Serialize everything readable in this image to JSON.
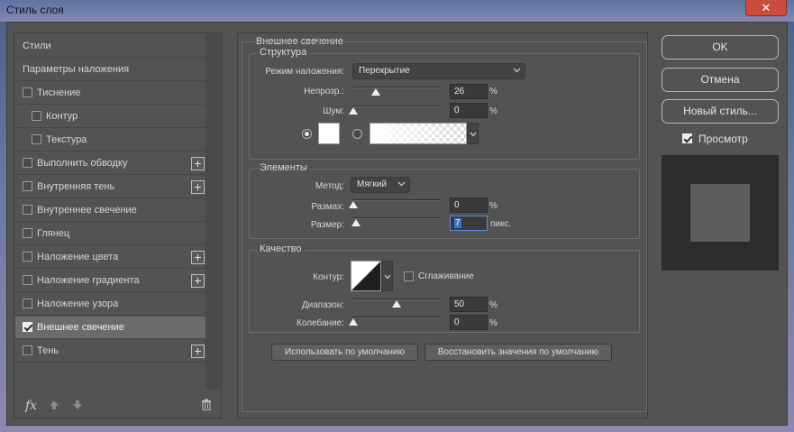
{
  "window": {
    "title": "Стиль слоя",
    "close_glyph": "✕"
  },
  "styles_list": {
    "items": [
      {
        "label": "Стили",
        "has_checkbox": false,
        "checked": false,
        "has_add": false,
        "indent": false,
        "selected": false
      },
      {
        "label": "Параметры наложения",
        "has_checkbox": false,
        "checked": false,
        "has_add": false,
        "indent": false,
        "selected": false
      },
      {
        "label": "Тиснение",
        "has_checkbox": true,
        "checked": false,
        "has_add": false,
        "indent": false,
        "selected": false
      },
      {
        "label": "Контур",
        "has_checkbox": true,
        "checked": false,
        "has_add": false,
        "indent": true,
        "selected": false
      },
      {
        "label": "Текстура",
        "has_checkbox": true,
        "checked": false,
        "has_add": false,
        "indent": true,
        "selected": false
      },
      {
        "label": "Выполнить обводку",
        "has_checkbox": true,
        "checked": false,
        "has_add": true,
        "indent": false,
        "selected": false
      },
      {
        "label": "Внутренняя тень",
        "has_checkbox": true,
        "checked": false,
        "has_add": true,
        "indent": false,
        "selected": false
      },
      {
        "label": "Внутреннее свечение",
        "has_checkbox": true,
        "checked": false,
        "has_add": false,
        "indent": false,
        "selected": false
      },
      {
        "label": "Глянец",
        "has_checkbox": true,
        "checked": false,
        "has_add": false,
        "indent": false,
        "selected": false
      },
      {
        "label": "Наложение цвета",
        "has_checkbox": true,
        "checked": false,
        "has_add": true,
        "indent": false,
        "selected": false
      },
      {
        "label": "Наложение градиента",
        "has_checkbox": true,
        "checked": false,
        "has_add": true,
        "indent": false,
        "selected": false
      },
      {
        "label": "Наложение узора",
        "has_checkbox": true,
        "checked": false,
        "has_add": false,
        "indent": false,
        "selected": false
      },
      {
        "label": "Внешнее свечение",
        "has_checkbox": true,
        "checked": true,
        "has_add": false,
        "indent": false,
        "selected": true
      },
      {
        "label": "Тень",
        "has_checkbox": true,
        "checked": false,
        "has_add": true,
        "indent": false,
        "selected": false
      }
    ],
    "footer": {
      "fx_label": "fx"
    }
  },
  "outer_glow": {
    "section_title": "Внешнее свечение",
    "structure": {
      "title": "Структура",
      "blend_mode_label": "Режим наложения:",
      "blend_mode_value": "Перекрытие",
      "opacity_label": "Непрозр.:",
      "opacity_value": "26",
      "opacity_unit": "%",
      "opacity_fraction": 0.26,
      "noise_label": "Шум:",
      "noise_value": "0",
      "noise_unit": "%",
      "noise_fraction": 0.0,
      "color_mode": "solid",
      "glow_color": "#ffffff"
    },
    "elements": {
      "title": "Элементы",
      "technique_label": "Метод:",
      "technique_value": "Мягкий",
      "spread_label": "Размах:",
      "spread_value": "0",
      "spread_unit": "%",
      "spread_fraction": 0.0,
      "size_label": "Размер:",
      "size_value": "7",
      "size_unit": "пикс.",
      "size_fraction": 0.03
    },
    "quality": {
      "title": "Качество",
      "contour_label": "Контур:",
      "antialias_label": "Сглаживание",
      "antialias_checked": false,
      "range_label": "Диапазон:",
      "range_value": "50",
      "range_unit": "%",
      "range_fraction": 0.5,
      "jitter_label": "Колебание:",
      "jitter_value": "0",
      "jitter_unit": "%",
      "jitter_fraction": 0.0
    },
    "make_default_label": "Использовать по умолчанию",
    "reset_default_label": "Восстановить значения по умолчанию"
  },
  "actions": {
    "ok_label": "OK",
    "cancel_label": "Отмена",
    "new_style_label": "Новый стиль...",
    "preview_label": "Просмотр",
    "preview_checked": true
  },
  "colors": {
    "dialog_bg": "#535353",
    "selected_item_bg": "#6b6b6b",
    "active_input_highlight": "#3a73c9",
    "preview_bg": "#2c2c2c"
  }
}
